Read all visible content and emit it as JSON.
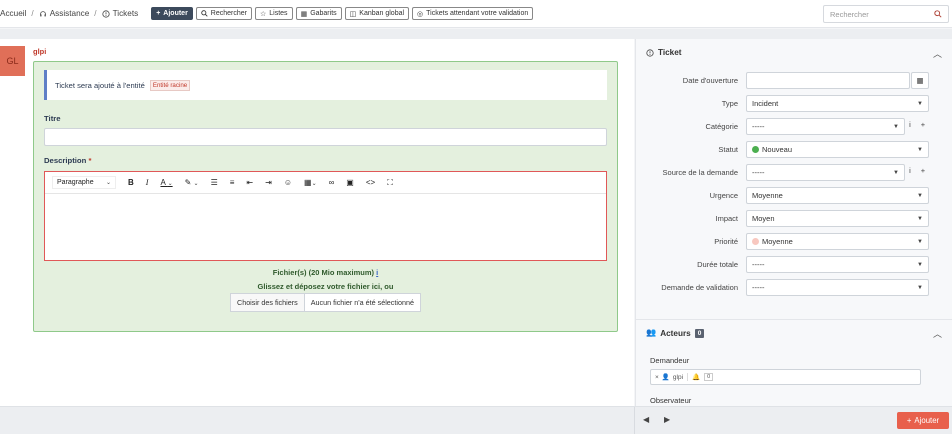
{
  "breadcrumb": {
    "home": "Accueil",
    "assistance": "Assistance",
    "tickets": "Tickets"
  },
  "actions": {
    "add": "Ajouter",
    "search": "Rechercher",
    "lists": "Listes",
    "templates": "Gabarits",
    "kanban": "Kanban global",
    "pending": "Tickets attendant votre validation"
  },
  "search": {
    "placeholder": "Rechercher"
  },
  "form": {
    "avatar": "GL",
    "user": "glpi",
    "notice": "Ticket sera ajouté à l'entité",
    "entity": "Entité racine",
    "title_label": "Titre",
    "title_value": "",
    "description_label": "Description",
    "required_mark": "*",
    "editor_format": "Paragraphe",
    "files_label": "Fichier(s) (20 Mio maximum)",
    "files_info": "i",
    "drop_text": "Glissez et déposez votre fichier ici, ou",
    "choose_files": "Choisir des fichiers",
    "no_file": "Aucun fichier n'a été sélectionné"
  },
  "ticket_panel": {
    "title": "Ticket",
    "fields": {
      "opening_date": {
        "label": "Date d'ouverture",
        "value": ""
      },
      "type": {
        "label": "Type",
        "value": "Incident"
      },
      "category": {
        "label": "Catégorie",
        "value": "-----"
      },
      "status": {
        "label": "Statut",
        "value": "Nouveau",
        "color": "#4caf50"
      },
      "source": {
        "label": "Source de la demande",
        "value": "-----"
      },
      "urgency": {
        "label": "Urgence",
        "value": "Moyenne"
      },
      "impact": {
        "label": "Impact",
        "value": "Moyen"
      },
      "priority": {
        "label": "Priorité",
        "value": "Moyenne",
        "color": "#f8c8c0"
      },
      "duration": {
        "label": "Durée totale",
        "value": "-----"
      },
      "validation": {
        "label": "Demande de validation",
        "value": "-----"
      }
    }
  },
  "actors_panel": {
    "title": "Acteurs",
    "count": "0",
    "requester_label": "Demandeur",
    "requester_tag": "glpi",
    "requester_notify_count": "0",
    "observer_label": "Observateur"
  },
  "footer": {
    "add": "Ajouter"
  },
  "colors": {
    "accent": "#e8604c",
    "success_border": "#8fc98a",
    "nav_primary": "#3c4a5c"
  }
}
